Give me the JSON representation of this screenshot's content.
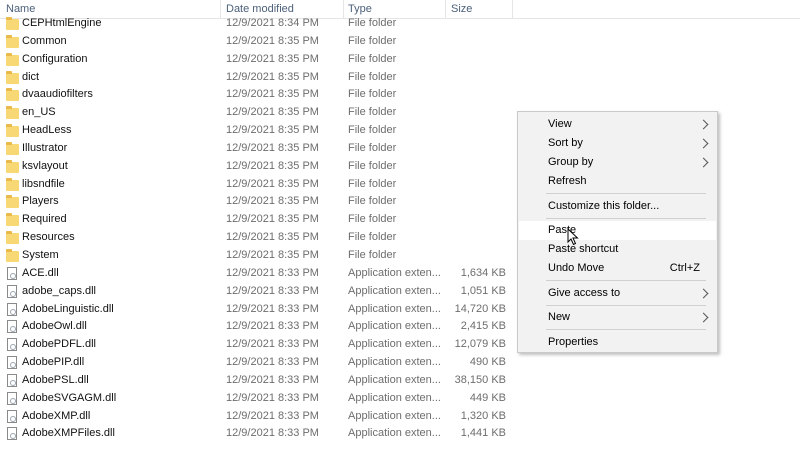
{
  "header": {
    "name": "Name",
    "date_modified": "Date modified",
    "type": "Type",
    "size": "Size"
  },
  "files": [
    {
      "name": "CEPHtmlEngine",
      "date": "12/9/2021 8:34 PM",
      "type": "File folder",
      "size": "",
      "kind": "folder"
    },
    {
      "name": "Common",
      "date": "12/9/2021 8:35 PM",
      "type": "File folder",
      "size": "",
      "kind": "folder"
    },
    {
      "name": "Configuration",
      "date": "12/9/2021 8:35 PM",
      "type": "File folder",
      "size": "",
      "kind": "folder"
    },
    {
      "name": "dict",
      "date": "12/9/2021 8:35 PM",
      "type": "File folder",
      "size": "",
      "kind": "folder"
    },
    {
      "name": "dvaaudiofilters",
      "date": "12/9/2021 8:35 PM",
      "type": "File folder",
      "size": "",
      "kind": "folder"
    },
    {
      "name": "en_US",
      "date": "12/9/2021 8:35 PM",
      "type": "File folder",
      "size": "",
      "kind": "folder"
    },
    {
      "name": "HeadLess",
      "date": "12/9/2021 8:35 PM",
      "type": "File folder",
      "size": "",
      "kind": "folder"
    },
    {
      "name": "Illustrator",
      "date": "12/9/2021 8:35 PM",
      "type": "File folder",
      "size": "",
      "kind": "folder"
    },
    {
      "name": "ksvlayout",
      "date": "12/9/2021 8:35 PM",
      "type": "File folder",
      "size": "",
      "kind": "folder"
    },
    {
      "name": "libsndfile",
      "date": "12/9/2021 8:35 PM",
      "type": "File folder",
      "size": "",
      "kind": "folder"
    },
    {
      "name": "Players",
      "date": "12/9/2021 8:35 PM",
      "type": "File folder",
      "size": "",
      "kind": "folder"
    },
    {
      "name": "Required",
      "date": "12/9/2021 8:35 PM",
      "type": "File folder",
      "size": "",
      "kind": "folder"
    },
    {
      "name": "Resources",
      "date": "12/9/2021 8:35 PM",
      "type": "File folder",
      "size": "",
      "kind": "folder"
    },
    {
      "name": "System",
      "date": "12/9/2021 8:35 PM",
      "type": "File folder",
      "size": "",
      "kind": "folder"
    },
    {
      "name": "ACE.dll",
      "date": "12/9/2021 8:33 PM",
      "type": "Application exten...",
      "size": "1,634 KB",
      "kind": "file"
    },
    {
      "name": "adobe_caps.dll",
      "date": "12/9/2021 8:33 PM",
      "type": "Application exten...",
      "size": "1,051 KB",
      "kind": "file"
    },
    {
      "name": "AdobeLinguistic.dll",
      "date": "12/9/2021 8:33 PM",
      "type": "Application exten...",
      "size": "14,720 KB",
      "kind": "file"
    },
    {
      "name": "AdobeOwl.dll",
      "date": "12/9/2021 8:33 PM",
      "type": "Application exten...",
      "size": "2,415 KB",
      "kind": "file"
    },
    {
      "name": "AdobePDFL.dll",
      "date": "12/9/2021 8:33 PM",
      "type": "Application exten...",
      "size": "12,079 KB",
      "kind": "file"
    },
    {
      "name": "AdobePIP.dll",
      "date": "12/9/2021 8:33 PM",
      "type": "Application exten...",
      "size": "490 KB",
      "kind": "file"
    },
    {
      "name": "AdobePSL.dll",
      "date": "12/9/2021 8:33 PM",
      "type": "Application exten...",
      "size": "38,150 KB",
      "kind": "file"
    },
    {
      "name": "AdobeSVGAGM.dll",
      "date": "12/9/2021 8:33 PM",
      "type": "Application exten...",
      "size": "449 KB",
      "kind": "file"
    },
    {
      "name": "AdobeXMP.dll",
      "date": "12/9/2021 8:33 PM",
      "type": "Application exten...",
      "size": "1,320 KB",
      "kind": "file"
    },
    {
      "name": "AdobeXMPFiles.dll",
      "date": "12/9/2021 8:33 PM",
      "type": "Application exten...",
      "size": "1,441 KB",
      "kind": "file"
    }
  ],
  "context_menu": {
    "items": [
      {
        "label": "View",
        "submenu": true
      },
      {
        "label": "Sort by",
        "submenu": true
      },
      {
        "label": "Group by",
        "submenu": true
      },
      {
        "label": "Refresh"
      },
      {
        "separator": true
      },
      {
        "label": "Customize this folder..."
      },
      {
        "separator": true
      },
      {
        "label": "Paste",
        "hovered": true
      },
      {
        "label": "Paste shortcut"
      },
      {
        "label": "Undo Move",
        "shortcut": "Ctrl+Z"
      },
      {
        "separator": true
      },
      {
        "label": "Give access to",
        "submenu": true
      },
      {
        "separator": true
      },
      {
        "label": "New",
        "submenu": true
      },
      {
        "separator": true
      },
      {
        "label": "Properties"
      }
    ]
  },
  "icons": {
    "folder": "folder-icon",
    "file": "dll-file-icon",
    "submenu": "chevron-right-icon",
    "cursor": "mouse-pointer-icon",
    "sort": "sort-ascending-icon"
  },
  "colors": {
    "header_text": "#4c607a",
    "folder": "#f8d775",
    "menu_bg": "#f2f2f2",
    "menu_hover": "#ffffff"
  }
}
